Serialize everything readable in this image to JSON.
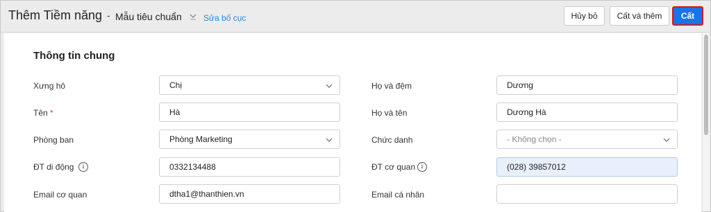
{
  "header": {
    "title": "Thêm Tiềm năng",
    "separator": "-",
    "template": "Mẫu tiêu chuẩn",
    "edit_layout": "Sửa bố cục",
    "cancel": "Hủy bỏ",
    "save_and_add": "Cất và thêm",
    "save": "Cất"
  },
  "section": {
    "title": "Thông tin chung"
  },
  "fields": {
    "salutation": {
      "label": "Xưng hô",
      "value": "Chị"
    },
    "first_name": {
      "label": "Tên",
      "required": "*",
      "value": "Hà"
    },
    "department": {
      "label": "Phòng ban",
      "value": "Phòng Marketing"
    },
    "mobile": {
      "label": "ĐT di động",
      "value": "0332134488",
      "info": "i"
    },
    "work_email": {
      "label": "Email cơ quan",
      "value": "dtha1@thanthien.vn"
    },
    "last_middle": {
      "label": "Họ và đệm",
      "value": "Dương"
    },
    "full_name": {
      "label": "Họ và tên",
      "value": "Dương Hà"
    },
    "job_title": {
      "label": "Chức danh",
      "placeholder": "- Không chọn -"
    },
    "office_phone": {
      "label": "ĐT cơ quan",
      "value": "(028) 39857012",
      "info": "i"
    },
    "personal_email": {
      "label": "Email cá nhân",
      "value": ""
    }
  },
  "colors": {
    "primary": "#1a73e8",
    "link": "#1e88e5",
    "highlight_border": "#d01c1c",
    "readonly_bg": "#e8f0fb"
  }
}
